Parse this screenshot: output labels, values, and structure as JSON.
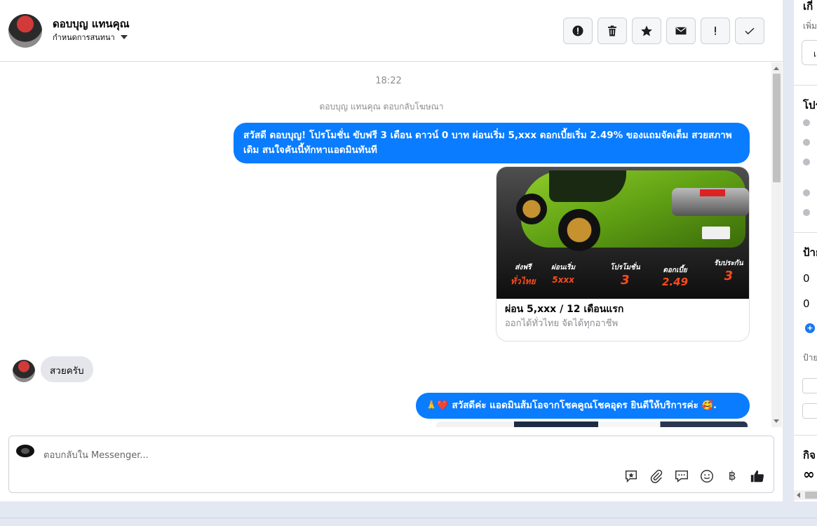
{
  "header": {
    "name": "ดอบบุญ แทนคุณ",
    "subtitle": "กำหนดการสนทนา",
    "actions": [
      {
        "icon": "exclamation-circle-icon"
      },
      {
        "icon": "trash-icon"
      },
      {
        "icon": "star-icon"
      },
      {
        "icon": "envelope-icon"
      },
      {
        "icon": "exclamation-icon"
      },
      {
        "icon": "checkmark-icon"
      }
    ]
  },
  "thread": {
    "timestamp": "18:22",
    "meta": "ดอบบุญ แทนคุณ ตอบกลับโฆษณา",
    "outgoing_1": "สวัสดี ดอบบุญ! โปรโมชั่น ขับฟรี 3 เดือน ดาวน์ 0 บาท ผ่อนเริ่ม 5,xxx  ดอกเบี้ยเริ่ม 2.49% ของแถมจัดเต็ม สวยสภาพเดิม สนใจคันนี้ทักหาแอดมินทันที",
    "ad": {
      "title": "ผ่อน 5,xxx / 12 เดือนแรก",
      "subtitle": "ออกได้ทั่วไทย จัดได้ทุกอาชีพ",
      "promo": {
        "free_ship": "ส่งฟรี",
        "nationwide": "ทั่วไทย",
        "installment": "ผ่อนเริ่ม",
        "installment_value": "5xxx",
        "promotion": "โปรโมชั่น",
        "promotion_value": "3",
        "interest": "ดอกเบี้ย",
        "interest_value": "2.49",
        "insurance": "รับประกัน",
        "insurance_value": "3"
      }
    },
    "incoming_1": "สวยครับ",
    "outgoing_2_emoji_left": "🙏❤️",
    "outgoing_2": "สวัสดีค่ะ แอดมินส้มโอจากโชคคูณโชคอุดร ยินดีให้บริการค่ะ",
    "outgoing_2_emoji_right": "🥰."
  },
  "composer": {
    "placeholder": "ตอบกลับใน Messenger...",
    "tools": [
      "saved-reply-icon",
      "paperclip-icon",
      "chat-bubbles-icon",
      "emoji-icon",
      "baht-icon",
      "thumbs-up-icon"
    ],
    "baht_symbol": "฿"
  },
  "right_panel": {
    "heading_1": "เกี่",
    "small_1": "เพิ่ม",
    "btn_1": "เ",
    "heading_2": "โปร",
    "heading_3": "ป้าย",
    "item_1": "0",
    "item_2": "0",
    "small_2": "ป้าย",
    "heading_4": "กิจ",
    "footer_icon": "∞"
  },
  "colors": {
    "accent": "#0a7cff",
    "incoming_bg": "#e4e6eb",
    "page_bg": "#e4e8f2"
  }
}
